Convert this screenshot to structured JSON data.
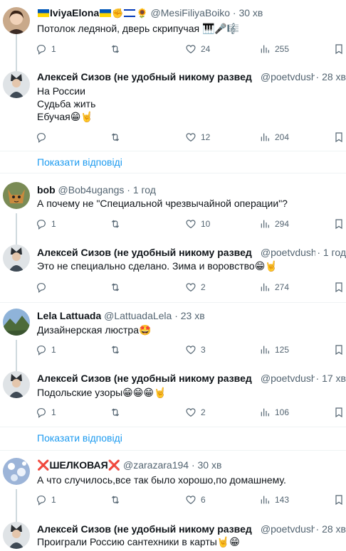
{
  "tweets": [
    {
      "name": "IviyaElona",
      "handle": "@MesiFiliyaBoiko",
      "time": "· 30 хв",
      "text": "Потолок ледяной, дверь скрипучая 🎹🎤🎼",
      "replies": "1",
      "retweets": "",
      "likes": "24",
      "views": "255"
    },
    {
      "name": "Алексей Сизов (не удобный никому развед",
      "handle": "@poetvdushe",
      "time": "· 28 хв",
      "text": "На России\nСудьба жить\nЕбучая😁🤘",
      "replies": "",
      "retweets": "",
      "likes": "12",
      "views": "204"
    },
    {
      "name": "bob",
      "handle": "@Bob4ugangs",
      "time": "· 1 год",
      "text": "А почему не \"Специальной чрезвычайной операции\"?",
      "replies": "1",
      "retweets": "",
      "likes": "10",
      "views": "294"
    },
    {
      "name": "Алексей Сизов (не удобный никому развед",
      "handle": "@poetvdushe",
      "time": "· 1 год",
      "text": "Это не специально сделано. Зима и воровство😁🤘",
      "replies": "",
      "retweets": "",
      "likes": "2",
      "views": "274"
    },
    {
      "name": "Lela Lattuada",
      "handle": "@LattuadaLela",
      "time": "· 23 хв",
      "text": "Дизайнерская люстра🤩",
      "replies": "1",
      "retweets": "",
      "likes": "3",
      "views": "125"
    },
    {
      "name": "Алексей Сизов (не удобный никому развед",
      "handle": "@poetvdushe",
      "time": "· 17 хв",
      "text": "Подольские узоры😁😁😁🤘",
      "replies": "1",
      "retweets": "",
      "likes": "2",
      "views": "106"
    },
    {
      "name": "ШЕЛКОВАЯ",
      "handle": "@zarazara194",
      "time": "· 30 хв",
      "text": "А что случилось,все так было хорошо,по домашнему.",
      "replies": "1",
      "retweets": "",
      "likes": "6",
      "views": "143"
    },
    {
      "name": "Алексей Сизов (не удобный никому развед",
      "handle": "@poetvdushe",
      "time": "· 28 хв",
      "text": "Проиграли Россию сантехники в карты🤘😁",
      "replies": "",
      "retweets": "",
      "likes": "",
      "views": ""
    }
  ],
  "show_replies": "Показати відповіді",
  "icons": {
    "reply": "reply-icon",
    "retweet": "retweet-icon",
    "like": "heart-icon",
    "views": "views-icon",
    "bookmark": "bookmark-icon"
  },
  "colors": {
    "text": "#0f1419",
    "secondary": "#536471",
    "link": "#1d9bf0",
    "divider": "#eff3f4",
    "thread_line": "#cfd9de"
  }
}
